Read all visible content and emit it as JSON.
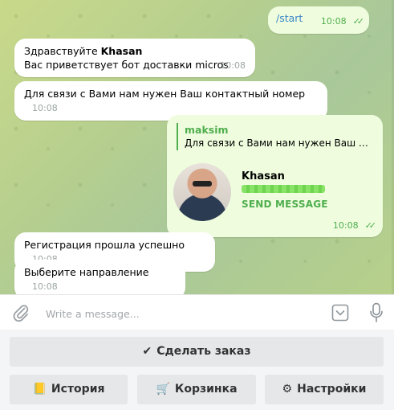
{
  "messages": {
    "start": {
      "text": "/start",
      "time": "10:08",
      "ticks": "✓✓"
    },
    "hello": {
      "greeting": "Здравствуйте ",
      "name": "Khasan",
      "line2": "Вас приветствует бот доставки micros",
      "time": "10:08"
    },
    "contact_request": {
      "text": "Для связи с Вами нам нужен Ваш контактный номер",
      "time": "10:08"
    },
    "contact_card": {
      "reply_name": "maksim",
      "reply_text": "Для связи с Вами нам нужен Ваш к...",
      "contact_name": "Khasan",
      "send_label": "SEND MESSAGE",
      "time": "10:08",
      "ticks": "✓✓"
    },
    "registration": {
      "text": "Регистрация прошла успешно",
      "time": "10:08"
    },
    "choose": {
      "text": "Выберите направление",
      "time": "10:08"
    }
  },
  "composer": {
    "placeholder": "Write a message..."
  },
  "keyboard": {
    "order": {
      "emoji": "✔",
      "label": "Сделать заказ"
    },
    "history": {
      "emoji": "📒",
      "label": "История"
    },
    "cart": {
      "emoji": "🛒",
      "label": "Корзинка"
    },
    "settings": {
      "emoji": "⚙",
      "label": "Настройки"
    }
  },
  "colors": {
    "accent": "#4fae4e",
    "link": "#3a86c8",
    "outgoing_bubble": "#effdde"
  }
}
